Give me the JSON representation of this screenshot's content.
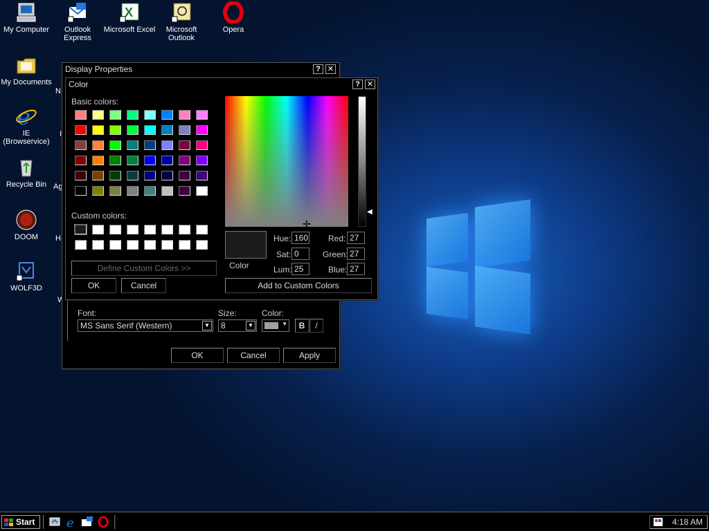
{
  "desktop": {
    "icons": [
      {
        "label": "My Computer"
      },
      {
        "label": "Outlook Express"
      },
      {
        "label": "Microsoft Excel"
      },
      {
        "label": "Microsoft Outlook"
      },
      {
        "label": "Opera"
      },
      {
        "label": "My Documents"
      },
      {
        "label": "IE (Browservice)"
      },
      {
        "label": "Recycle Bin"
      },
      {
        "label": "DOOM"
      },
      {
        "label": "WOLF3D"
      }
    ],
    "partial_labels": [
      "N",
      "I",
      "Ag",
      "H",
      "W"
    ]
  },
  "display_properties": {
    "title": "Display Properties",
    "help_glyph": "?",
    "close_glyph": "✕",
    "font_label": "Font:",
    "font_value": "MS Sans Serif (Western)",
    "size_label": "Size:",
    "size_value": "8",
    "color_label": "Color:",
    "bold_label": "B",
    "italic_label": "/",
    "ok_label": "OK",
    "cancel_label": "Cancel",
    "apply_label": "Apply"
  },
  "color_dialog": {
    "title": "Color",
    "help_glyph": "?",
    "close_glyph": "✕",
    "basic_colors_label": "Basic colors:",
    "custom_colors_label": "Custom colors:",
    "define_custom_label": "Define Custom Colors >>",
    "ok_label": "OK",
    "cancel_label": "Cancel",
    "add_custom_label": "Add to Custom Colors",
    "color_solid_label": "Color",
    "hue_label": "Hue:",
    "hue_value": "160",
    "sat_label": "Sat:",
    "sat_value": "0",
    "lum_label": "Lum:",
    "lum_value": "25",
    "red_label": "Red:",
    "red_value": "27",
    "green_label": "Green:",
    "green_value": "27",
    "blue_label": "Blue:",
    "blue_value": "27",
    "current_color": "#1b1b1b",
    "basic_colors": [
      [
        "#ff8080",
        "#ffff80",
        "#80ff80",
        "#00ff80",
        "#80ffff",
        "#0080ff",
        "#ff80c0",
        "#ff80ff"
      ],
      [
        "#ff0000",
        "#ffff00",
        "#80ff00",
        "#00ff40",
        "#00ffff",
        "#0080c0",
        "#8080c0",
        "#ff00ff"
      ],
      [
        "#804040",
        "#ff8040",
        "#00ff00",
        "#008080",
        "#004080",
        "#8080ff",
        "#800040",
        "#ff0080"
      ],
      [
        "#800000",
        "#ff8000",
        "#008000",
        "#008040",
        "#0000ff",
        "#0000a0",
        "#800080",
        "#8000ff"
      ],
      [
        "#400000",
        "#804000",
        "#004000",
        "#004040",
        "#000080",
        "#000040",
        "#400040",
        "#400080"
      ],
      [
        "#000000",
        "#808000",
        "#808040",
        "#808080",
        "#408080",
        "#c0c0c0",
        "#400040",
        "#ffffff"
      ]
    ],
    "custom_colors": [
      [
        "#1b1b1b",
        "#ffffff",
        "#ffffff",
        "#ffffff",
        "#ffffff",
        "#ffffff",
        "#ffffff",
        "#ffffff"
      ],
      [
        "#ffffff",
        "#ffffff",
        "#ffffff",
        "#ffffff",
        "#ffffff",
        "#ffffff",
        "#ffffff",
        "#ffffff"
      ]
    ]
  },
  "taskbar": {
    "start_label": "Start",
    "clock": "4:18 AM",
    "quick_launch": [
      "desktop-icon",
      "ie-icon",
      "outlook-express-icon",
      "opera-icon"
    ]
  }
}
